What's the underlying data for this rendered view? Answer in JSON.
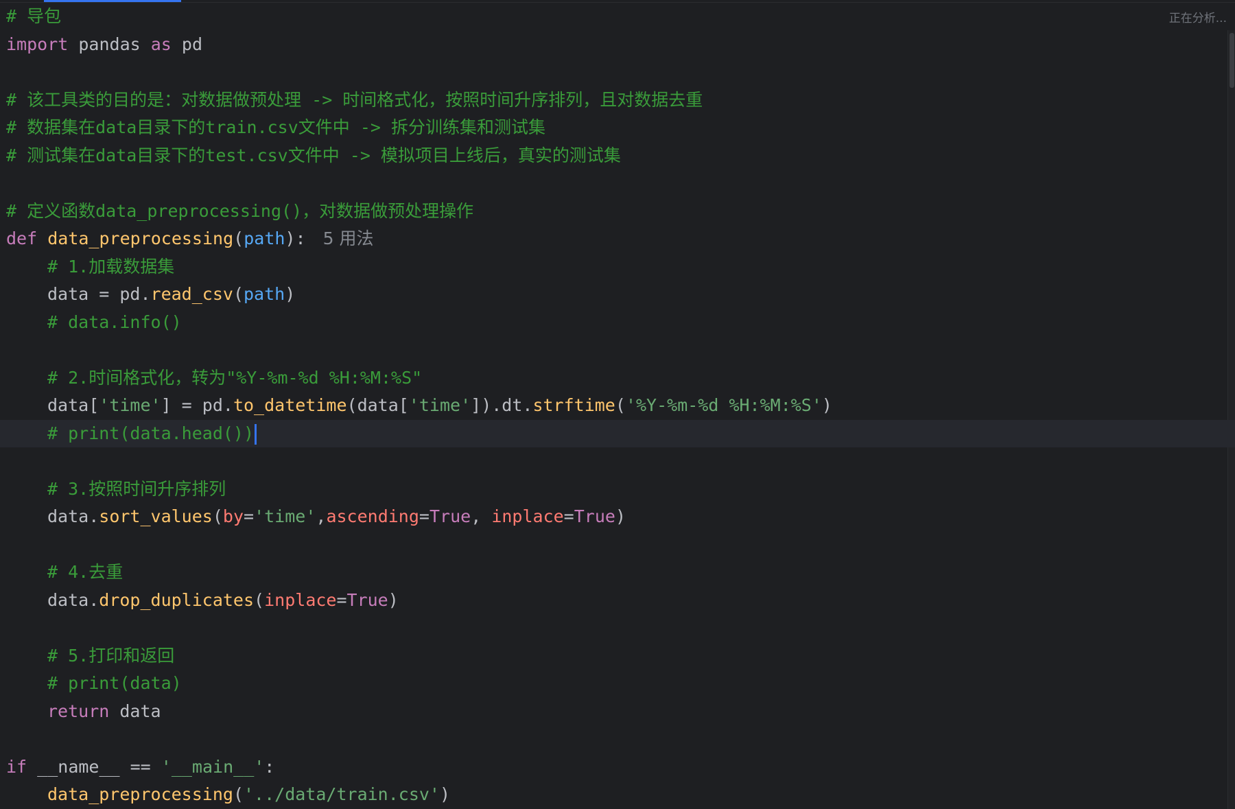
{
  "status": "正在分析...",
  "colors": {
    "background": "#1e1f22",
    "keyword": "#cf8e6d",
    "comment": "#3a9c3a",
    "string": "#6aab73",
    "function": "#ffc66d",
    "param": "#56a8f5",
    "caret": "#3574f0"
  },
  "code": {
    "l1": "# 导包",
    "l2_kw": "import",
    "l2_rest": " pandas ",
    "l2_as": "as",
    "l2_alias": " pd",
    "l4": "# 该工具类的目的是：对数据做预处理 -> 时间格式化，按照时间升序排列，且对数据去重",
    "l5": "# 数据集在data目录下的train.csv文件中 -> 拆分训练集和测试集",
    "l6": "# 测试集在data目录下的test.csv文件中 -> 模拟项目上线后，真实的测试集",
    "l8": "# 定义函数data_preprocessing()，对数据做预处理操作",
    "l9_kw": "def",
    "l9_fn": "data_preprocessing",
    "l9_param": "path",
    "l9_hint": "5 用法",
    "l10": "# 1.加载数据集",
    "l11_a": "data = pd.",
    "l11_fn": "read_csv",
    "l11_param": "path",
    "l12": "# data.info()",
    "l14": "# 2.时间格式化，转为\"%Y-%m-%d %H:%M:%S\"",
    "l15_a": "data[",
    "l15_s1": "'time'",
    "l15_b": "] = pd.",
    "l15_fn1": "to_datetime",
    "l15_c": "(data[",
    "l15_s2": "'time'",
    "l15_d": "]).dt.",
    "l15_fn2": "strftime",
    "l15_s3": "'%Y-%m-%d %H:%M:%S'",
    "l16": "# print(data.head())",
    "l18": "# 3.按照时间升序排列",
    "l19_a": "data.",
    "l19_fn": "sort_values",
    "l19_p1": "by",
    "l19_s1": "'time'",
    "l19_p2": "ascending",
    "l19_v2": "True",
    "l19_p3": "inplace",
    "l19_v3": "True",
    "l21": "# 4.去重",
    "l22_a": "data.",
    "l22_fn": "drop_duplicates",
    "l22_p1": "inplace",
    "l22_v1": "True",
    "l24": "# 5.打印和返回",
    "l25": "# print(data)",
    "l26_kw": "return",
    "l26_rest": " data",
    "l28_kw": "if",
    "l28_rest": " __name__ == ",
    "l28_str": "'__main__'",
    "l28_colon": ":",
    "l29_fn": "data_preprocessing",
    "l29_str": "'../data/train.csv'"
  }
}
